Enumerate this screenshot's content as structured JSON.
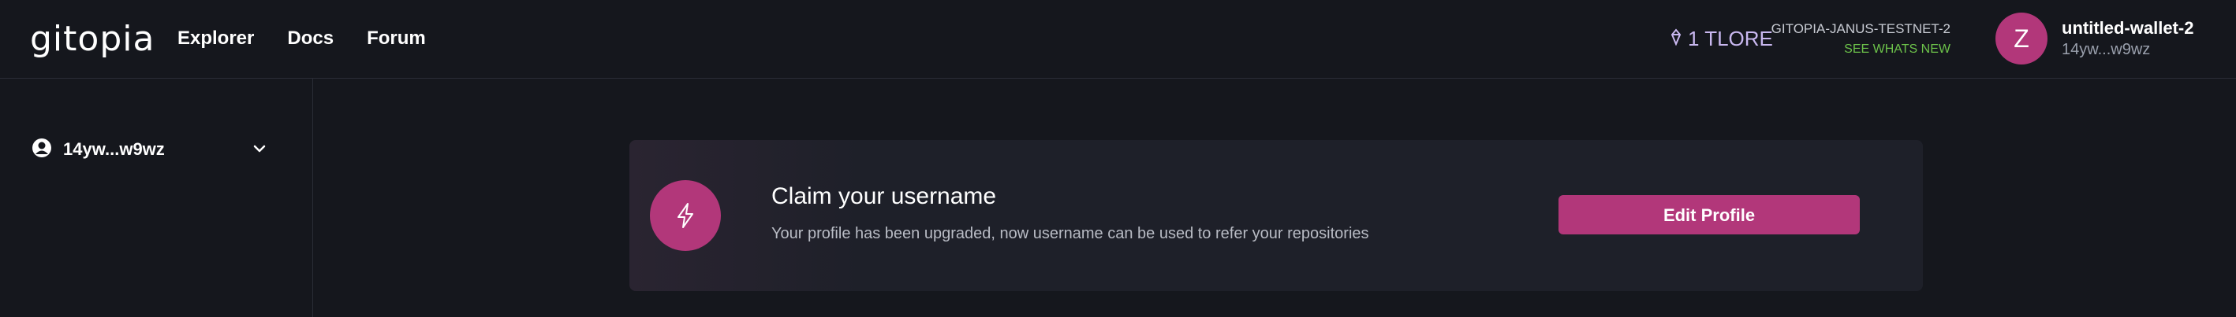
{
  "header": {
    "logo_text": "gitopia",
    "nav": [
      {
        "label": "Explorer"
      },
      {
        "label": "Docs"
      },
      {
        "label": "Forum"
      }
    ],
    "balance": "1 TLORE",
    "network_name": "GITOPIA-JANUS-TESTNET-2",
    "network_link": "SEE WHATS NEW",
    "avatar_letter": "Z",
    "wallet_name": "untitled-wallet-2",
    "wallet_address": "14yw...w9wz"
  },
  "sidebar": {
    "account_label": "14yw...w9wz"
  },
  "card": {
    "title": "Claim your username",
    "description": "Your profile has been upgraded, now username can be used to refer your repositories",
    "button_label": "Edit Profile"
  },
  "icons": {
    "logo": "gitopia-logo-icon",
    "balance": "token-icon",
    "account": "user-circle-icon",
    "chevron": "chevron-down-icon",
    "bolt": "lightning-bolt-icon"
  },
  "colors": {
    "background": "#15171d",
    "accent": "#b2377a",
    "balance_text": "#c9b8f0",
    "network_link": "#6cc24a"
  }
}
